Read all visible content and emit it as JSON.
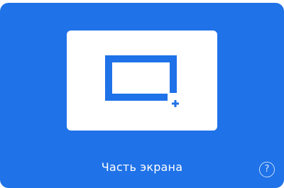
{
  "tile": {
    "label": "Часть экрана",
    "icon": "region-select-icon",
    "help_icon": "help-icon",
    "help_glyph": "?"
  },
  "colors": {
    "tile_background": "#1f72e8",
    "preview_background": "#ffffff",
    "icon_color": "#1f72e8",
    "label_color": "#ffffff"
  }
}
